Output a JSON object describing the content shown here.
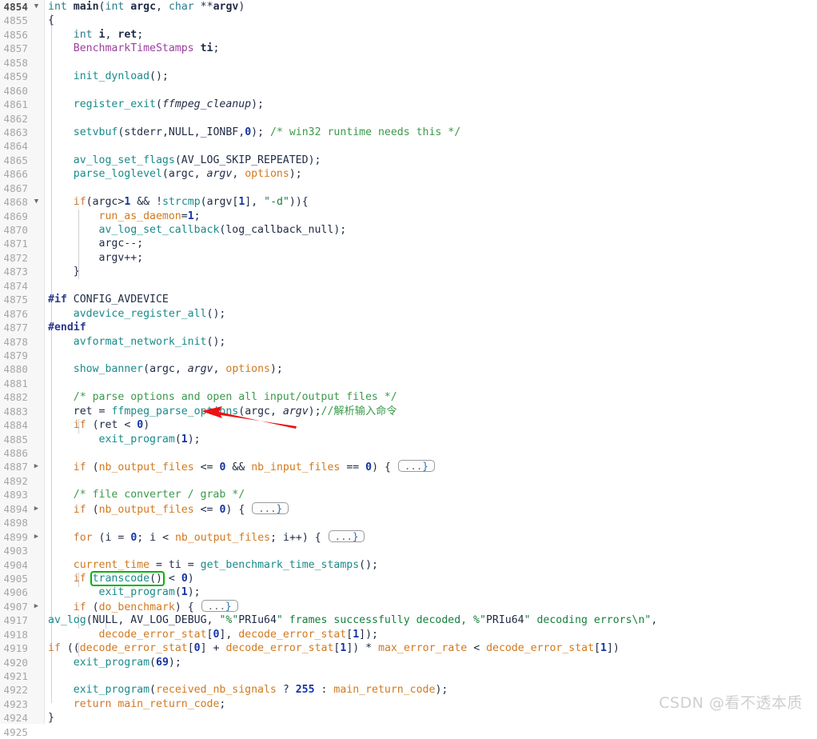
{
  "editor": {
    "language": "C",
    "file_context": "ffmpeg.c main()",
    "background": "#ffffff",
    "gutter_background": "#f7f7f7",
    "colors": {
      "keyword": "#cc7832",
      "type_keyword": "#2a7b8c",
      "function": "#1a8a8a",
      "identifier": "#1f2a44",
      "global_variable": "#d2791e",
      "user_type": "#9b3fa0",
      "number": "#1434a4",
      "string": "#167f3c",
      "comment": "#3a9a4a",
      "preprocessor": "#2b3a8f",
      "line_number": "#a6a6a6",
      "annotation_arrow": "#ee1111",
      "annotation_box": "#0ab10a",
      "watermark": "#cfcfcf"
    }
  },
  "annotations": {
    "arrow": {
      "type": "red-arrow",
      "points_at": "ffmpeg_parse_options",
      "on_line": "4883"
    },
    "highlight_box": {
      "type": "green-rectangle",
      "surrounds": "transcode()",
      "on_line": "4905"
    }
  },
  "watermark": {
    "text": "CSDN @看不透本质"
  },
  "lines": [
    {
      "num": "4854",
      "fold": "open",
      "current": true,
      "text": "int main(int argc, char **argv)"
    },
    {
      "num": "4855",
      "fold": "",
      "current": false,
      "text": "{"
    },
    {
      "num": "4856",
      "fold": "",
      "current": false,
      "text": "    int i, ret;"
    },
    {
      "num": "4857",
      "fold": "",
      "current": false,
      "text": "    BenchmarkTimeStamps ti;"
    },
    {
      "num": "4858",
      "fold": "",
      "current": false,
      "text": ""
    },
    {
      "num": "4859",
      "fold": "",
      "current": false,
      "text": "    init_dynload();"
    },
    {
      "num": "4860",
      "fold": "",
      "current": false,
      "text": ""
    },
    {
      "num": "4861",
      "fold": "",
      "current": false,
      "text": "    register_exit(ffmpeg_cleanup);"
    },
    {
      "num": "4862",
      "fold": "",
      "current": false,
      "text": ""
    },
    {
      "num": "4863",
      "fold": "",
      "current": false,
      "text": "    setvbuf(stderr,NULL,_IONBF,0); /* win32 runtime needs this */"
    },
    {
      "num": "4864",
      "fold": "",
      "current": false,
      "text": ""
    },
    {
      "num": "4865",
      "fold": "",
      "current": false,
      "text": "    av_log_set_flags(AV_LOG_SKIP_REPEATED);"
    },
    {
      "num": "4866",
      "fold": "",
      "current": false,
      "text": "    parse_loglevel(argc, argv, options);"
    },
    {
      "num": "4867",
      "fold": "",
      "current": false,
      "text": ""
    },
    {
      "num": "4868",
      "fold": "open",
      "current": false,
      "text": "    if(argc>1 && !strcmp(argv[1], \"-d\")){"
    },
    {
      "num": "4869",
      "fold": "",
      "current": false,
      "text": "        run_as_daemon=1;"
    },
    {
      "num": "4870",
      "fold": "",
      "current": false,
      "text": "        av_log_set_callback(log_callback_null);"
    },
    {
      "num": "4871",
      "fold": "",
      "current": false,
      "text": "        argc--;"
    },
    {
      "num": "4872",
      "fold": "",
      "current": false,
      "text": "        argv++;"
    },
    {
      "num": "4873",
      "fold": "",
      "current": false,
      "text": "    }"
    },
    {
      "num": "4874",
      "fold": "",
      "current": false,
      "text": ""
    },
    {
      "num": "4875",
      "fold": "",
      "current": false,
      "text": "#if CONFIG_AVDEVICE"
    },
    {
      "num": "4876",
      "fold": "",
      "current": false,
      "text": "    avdevice_register_all();"
    },
    {
      "num": "4877",
      "fold": "",
      "current": false,
      "text": "#endif"
    },
    {
      "num": "4878",
      "fold": "",
      "current": false,
      "text": "    avformat_network_init();"
    },
    {
      "num": "4879",
      "fold": "",
      "current": false,
      "text": ""
    },
    {
      "num": "4880",
      "fold": "",
      "current": false,
      "text": "    show_banner(argc, argv, options);"
    },
    {
      "num": "4881",
      "fold": "",
      "current": false,
      "text": ""
    },
    {
      "num": "4882",
      "fold": "",
      "current": false,
      "text": "    /* parse options and open all input/output files */"
    },
    {
      "num": "4883",
      "fold": "",
      "current": false,
      "text": "    ret = ffmpeg_parse_options(argc, argv);//解析输入命令"
    },
    {
      "num": "4884",
      "fold": "",
      "current": false,
      "text": "    if (ret < 0)"
    },
    {
      "num": "4885",
      "fold": "",
      "current": false,
      "text": "        exit_program(1);"
    },
    {
      "num": "4886",
      "fold": "",
      "current": false,
      "text": ""
    },
    {
      "num": "4887",
      "fold": "closed",
      "current": false,
      "text": "    if (nb_output_files <= 0 && nb_input_files == 0) { ...}"
    },
    {
      "num": "4892",
      "fold": "",
      "current": false,
      "text": ""
    },
    {
      "num": "4893",
      "fold": "",
      "current": false,
      "text": "    /* file converter / grab */"
    },
    {
      "num": "4894",
      "fold": "closed",
      "current": false,
      "text": "    if (nb_output_files <= 0) { ...}"
    },
    {
      "num": "4898",
      "fold": "",
      "current": false,
      "text": ""
    },
    {
      "num": "4899",
      "fold": "closed",
      "current": false,
      "text": "    for (i = 0; i < nb_output_files; i++) { ...}"
    },
    {
      "num": "4903",
      "fold": "",
      "current": false,
      "text": ""
    },
    {
      "num": "4904",
      "fold": "",
      "current": false,
      "text": "    current_time = ti = get_benchmark_time_stamps();"
    },
    {
      "num": "4905",
      "fold": "",
      "current": false,
      "text": "    if (transcode() < 0)"
    },
    {
      "num": "4906",
      "fold": "",
      "current": false,
      "text": "        exit_program(1);"
    },
    {
      "num": "4907",
      "fold": "closed",
      "current": false,
      "text": "    if (do_benchmark) { ...}"
    },
    {
      "num": "4917",
      "fold": "",
      "current": false,
      "text": "    av_log(NULL, AV_LOG_DEBUG, \"%\"PRIu64\" frames successfully decoded, %\"PRIu64\" decoding errors\\n\","
    },
    {
      "num": "4918",
      "fold": "",
      "current": false,
      "text": "           decode_error_stat[0], decode_error_stat[1]);"
    },
    {
      "num": "4919",
      "fold": "",
      "current": false,
      "text": "    if ((decode_error_stat[0] + decode_error_stat[1]) * max_error_rate < decode_error_stat[1])"
    },
    {
      "num": "4920",
      "fold": "",
      "current": false,
      "text": "        exit_program(69);"
    },
    {
      "num": "4921",
      "fold": "",
      "current": false,
      "text": ""
    },
    {
      "num": "4922",
      "fold": "",
      "current": false,
      "text": "    exit_program(received_nb_signals ? 255 : main_return_code);"
    },
    {
      "num": "4923",
      "fold": "",
      "current": false,
      "text": "    return main_return_code;"
    },
    {
      "num": "4924",
      "fold": "",
      "current": false,
      "text": "}"
    },
    {
      "num": "4925",
      "fold": "",
      "current": false,
      "text": ""
    }
  ]
}
